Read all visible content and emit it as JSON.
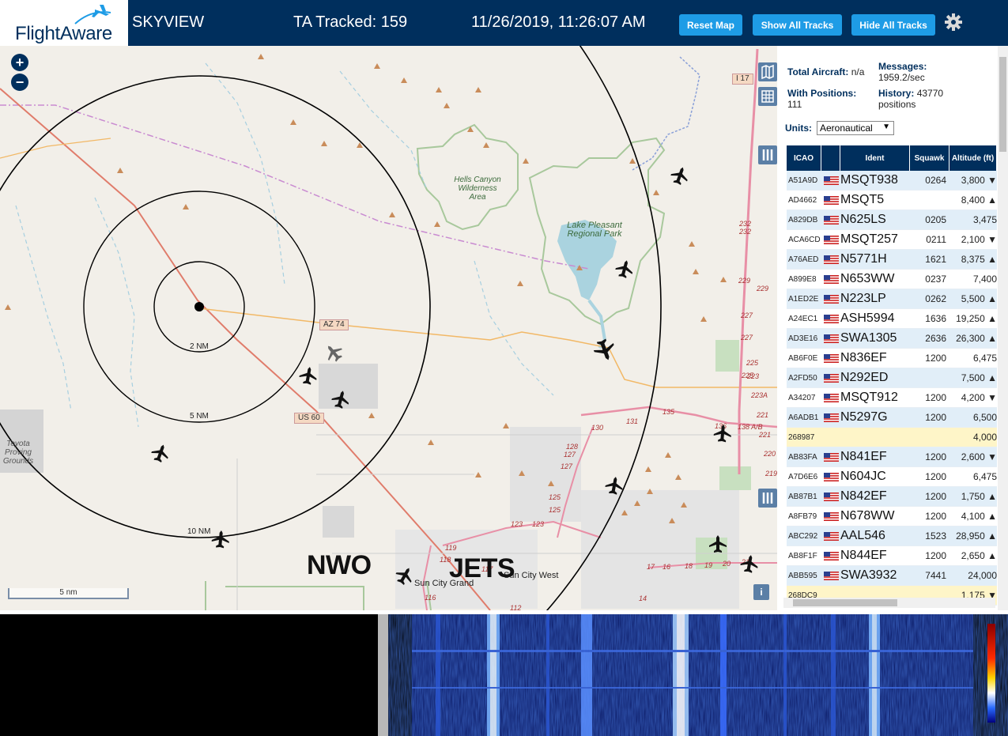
{
  "header": {
    "logo_text": "FlightAware",
    "app_title": "SKYVIEW",
    "tracked": "TA Tracked: 159",
    "datetime": "11/26/2019, 11:26:07 AM",
    "buttons": [
      "Reset Map",
      "Show All Tracks",
      "Hide All Tracks"
    ],
    "settings_icon": "gear-icon"
  },
  "map": {
    "zoom_in": "+",
    "zoom_out": "−",
    "rings": [
      "2 NM",
      "5 NM",
      "10 NM"
    ],
    "roads": [
      "AZ 74",
      "US 60",
      "I 17"
    ],
    "places": {
      "hells_canyon": "Hells Canyon Wilderness Area",
      "lake_pleasant": "Lake Pleasant Regional Park",
      "toyota": "Toyota Proving Grounds",
      "sun_city_grand": "Sun City Grand",
      "sun_city_west": "Sun City West"
    },
    "annotations": [
      "NWO",
      "JETS"
    ],
    "route_numbers": [
      "232",
      "232",
      "229",
      "229",
      "227",
      "227",
      "225",
      "225",
      "223",
      "223A",
      "221",
      "221",
      "220",
      "219",
      "131",
      "130",
      "135",
      "136",
      "138 A/B",
      "128",
      "127",
      "127",
      "125",
      "125",
      "123",
      "123",
      "119",
      "118",
      "116",
      "117",
      "17",
      "16",
      "18",
      "19",
      "20",
      "21",
      "14",
      "112"
    ],
    "scale_label": "5 nm",
    "info_label": "i"
  },
  "sidebar": {
    "total_aircraft_label": "Total Aircraft:",
    "total_aircraft_value": "n/a",
    "messages_label": "Messages:",
    "messages_value": "1959.2/sec",
    "with_positions_label": "With Positions:",
    "with_positions_value": "111",
    "history_label": "History:",
    "history_value": "43770",
    "history_unit": "positions",
    "units_label": "Units:",
    "units_value": "Aeronautical",
    "columns": [
      "ICAO",
      "",
      "Ident",
      "Squawk",
      "Altitude (ft)"
    ],
    "rows": [
      {
        "icao": "A51A9D",
        "flag": true,
        "ident": "MSQT938",
        "squawk": "0264",
        "alt": "3,800 ▼",
        "kind": "odd"
      },
      {
        "icao": "AD4662",
        "flag": true,
        "ident": "MSQT5",
        "squawk": "",
        "alt": "8,400 ▲",
        "kind": "even"
      },
      {
        "icao": "A829DB",
        "flag": true,
        "ident": "N625LS",
        "squawk": "0205",
        "alt": "3,475",
        "kind": "odd"
      },
      {
        "icao": "ACA6CD",
        "flag": true,
        "ident": "MSQT257",
        "squawk": "0211",
        "alt": "2,100 ▼",
        "kind": "even"
      },
      {
        "icao": "A76AED",
        "flag": true,
        "ident": "N5771H",
        "squawk": "1621",
        "alt": "8,375 ▲",
        "kind": "odd"
      },
      {
        "icao": "A899E8",
        "flag": true,
        "ident": "N653WW",
        "squawk": "0237",
        "alt": "7,400",
        "kind": "even"
      },
      {
        "icao": "A1ED2E",
        "flag": true,
        "ident": "N223LP",
        "squawk": "0262",
        "alt": "5,500 ▲",
        "kind": "odd"
      },
      {
        "icao": "A24EC1",
        "flag": true,
        "ident": "ASH5994",
        "squawk": "1636",
        "alt": "19,250 ▲",
        "kind": "even"
      },
      {
        "icao": "AD3E16",
        "flag": true,
        "ident": "SWA1305",
        "squawk": "2636",
        "alt": "26,300 ▲",
        "kind": "odd"
      },
      {
        "icao": "AB6F0E",
        "flag": true,
        "ident": "N836EF",
        "squawk": "1200",
        "alt": "6,475",
        "kind": "even"
      },
      {
        "icao": "A2FD50",
        "flag": true,
        "ident": "N292ED",
        "squawk": "",
        "alt": "7,500 ▲",
        "kind": "odd"
      },
      {
        "icao": "A34207",
        "flag": true,
        "ident": "MSQT912",
        "squawk": "1200",
        "alt": "4,200 ▼",
        "kind": "even"
      },
      {
        "icao": "A6ADB1",
        "flag": true,
        "ident": "N5297G",
        "squawk": "1200",
        "alt": "6,500",
        "kind": "odd"
      },
      {
        "icao": "268987",
        "flag": false,
        "ident": "",
        "squawk": "",
        "alt": "4,000",
        "kind": "nopos"
      },
      {
        "icao": "AB83FA",
        "flag": true,
        "ident": "N841EF",
        "squawk": "1200",
        "alt": "2,600 ▼",
        "kind": "odd"
      },
      {
        "icao": "A7D6E6",
        "flag": true,
        "ident": "N604JC",
        "squawk": "1200",
        "alt": "6,475",
        "kind": "even"
      },
      {
        "icao": "AB87B1",
        "flag": true,
        "ident": "N842EF",
        "squawk": "1200",
        "alt": "1,750 ▲",
        "kind": "odd"
      },
      {
        "icao": "A8FB79",
        "flag": true,
        "ident": "N678WW",
        "squawk": "1200",
        "alt": "4,100 ▲",
        "kind": "even"
      },
      {
        "icao": "ABC292",
        "flag": true,
        "ident": "AAL546",
        "squawk": "1523",
        "alt": "28,950 ▲",
        "kind": "odd"
      },
      {
        "icao": "AB8F1F",
        "flag": true,
        "ident": "N844EF",
        "squawk": "1200",
        "alt": "2,650 ▲",
        "kind": "even"
      },
      {
        "icao": "ABB595",
        "flag": true,
        "ident": "SWA3932",
        "squawk": "7441",
        "alt": "24,000",
        "kind": "odd"
      },
      {
        "icao": "268DC9",
        "flag": false,
        "ident": "",
        "squawk": "",
        "alt": "1,175 ▼",
        "kind": "nopos"
      }
    ]
  },
  "colors": {
    "header_bg": "#002f5d",
    "button_bg": "#1e9ce6",
    "map_bg": "#f2efe9",
    "row_odd": "#e1eef8",
    "row_nopos": "#fef5c8"
  }
}
